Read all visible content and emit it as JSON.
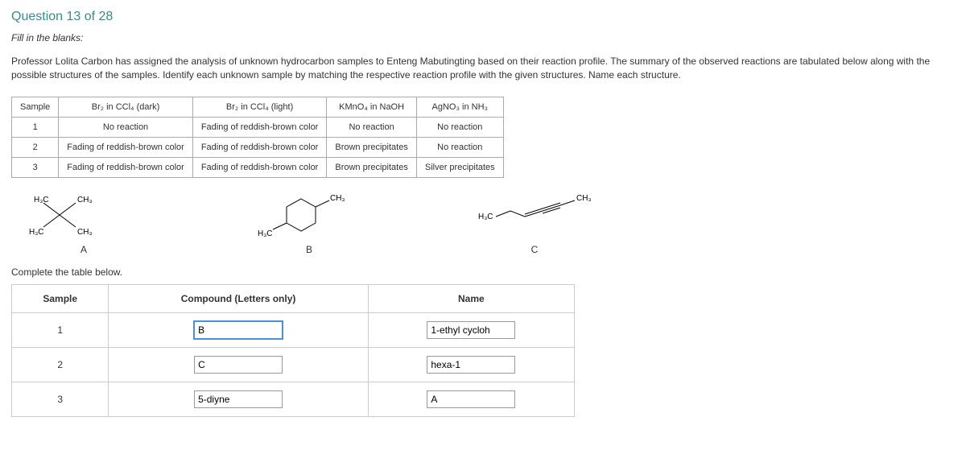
{
  "header": {
    "title": "Question 13 of 28"
  },
  "instruction": "Fill in the blanks:",
  "paragraph": "Professor Lolita Carbon has assigned the analysis of unknown hydrocarbon samples to Enteng Mabutingting based on their reaction profile.  The summary of the observed reactions are tabulated below along with the possible structures of the samples. Identify each unknown sample by matching the respective reaction profile with the given structures.  Name each structure.",
  "rx_table": {
    "headers": [
      "Sample",
      "Br₂ in CCl₄ (dark)",
      "Br₂ in CCl₄ (light)",
      "KMnO₄ in NaOH",
      "AgNO₃ in NH₃"
    ],
    "rows": [
      {
        "sample": "1",
        "c1": "No reaction",
        "c2": "Fading of reddish-brown color",
        "c3": "No reaction",
        "c4": "No reaction"
      },
      {
        "sample": "2",
        "c1": "Fading of reddish-brown color",
        "c2": "Fading of reddish-brown color",
        "c3": "Brown precipitates",
        "c4": "No reaction"
      },
      {
        "sample": "3",
        "c1": "Fading of reddish-brown color",
        "c2": "Fading of reddish-brown color",
        "c3": "Brown precipitates",
        "c4": "Silver precipitates"
      }
    ]
  },
  "structures": {
    "a_label": "A",
    "b_label": "B",
    "c_label": "C"
  },
  "complete_text": "Complete the table below.",
  "ans_table": {
    "headers": {
      "sample": "Sample",
      "compound": "Compound (Letters only)",
      "name": "Name"
    },
    "rows": [
      {
        "sample": "1",
        "compound": "B",
        "name": "1-ethyl cycloh"
      },
      {
        "sample": "2",
        "compound": "C",
        "name": "hexa-1"
      },
      {
        "sample": "3",
        "compound": "5-diyne",
        "name": "A"
      }
    ]
  },
  "chem": {
    "h3c": "H₃C",
    "ch3": "CH₃"
  }
}
